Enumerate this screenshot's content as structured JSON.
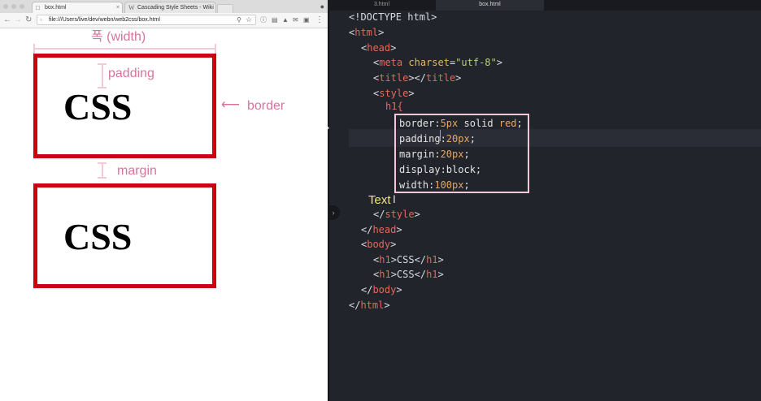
{
  "browser": {
    "tabs": [
      {
        "icon": "document-icon",
        "label": "box.html",
        "active": true
      },
      {
        "icon": "wikipedia-icon",
        "favicon_text": "W",
        "label": "Cascading Style Sheets - Wiki",
        "active": false
      }
    ],
    "url": "file:///Users/live/dev/webn/web2css/box.html",
    "page": {
      "box1_text": "CSS",
      "box2_text": "CSS",
      "width_label": "폭 (width)",
      "padding_label": "padding",
      "border_label": "border",
      "margin_label": "margin"
    }
  },
  "editor": {
    "tabs": [
      {
        "label": "3.html",
        "active": false
      },
      {
        "label": "box.html",
        "active": true
      }
    ],
    "code": {
      "doctype": "<!DOCTYPE html>",
      "html_open": "html",
      "head_open": "head",
      "meta_tag": "meta",
      "meta_attr": "charset",
      "meta_value": "\"utf-8\"",
      "title_tag": "title",
      "style_tag": "style",
      "selector": "h1{",
      "decls": [
        {
          "prop": "border:",
          "value": "5px",
          "rest": " solid ",
          "value2": "red",
          "end": ";"
        },
        {
          "prop": "padding:",
          "value": "20px",
          "rest": "",
          "value2": "",
          "end": ";"
        },
        {
          "prop": "margin:",
          "value": "20px",
          "rest": "",
          "value2": "",
          "end": ";"
        },
        {
          "prop": "display:block",
          "value": "",
          "rest": "",
          "value2": "",
          "end": ";"
        },
        {
          "prop": "width:",
          "value": "100px",
          "rest": "",
          "value2": "",
          "end": ";"
        }
      ],
      "text_label": "Text",
      "head_close": "head",
      "body_open": "body",
      "h1_tag": "h1",
      "h1_text_1": "CSS",
      "h1_text_2": "CSS",
      "body_close": "body",
      "html_close": "html"
    }
  },
  "colors": {
    "box_border": "#cc0011",
    "annotation": "#d8749c",
    "editor_bg": "#22242c",
    "tag": "#e5685b",
    "attribute": "#e2b868",
    "string": "#b4d273",
    "number": "#e6a760",
    "highlight_box": "#f3c7d3"
  }
}
